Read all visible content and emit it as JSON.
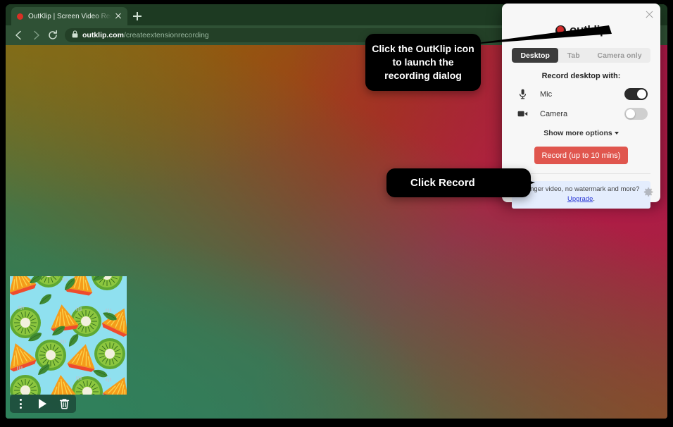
{
  "browser": {
    "tab": {
      "title": "OutKlip | Screen Video Recorde",
      "favicon": "red-dot-favicon",
      "close_icon": "close-icon"
    },
    "new_tab_label": "+",
    "window_close_icon": "window-close-icon",
    "nav": {
      "back_icon": "back-arrow-icon",
      "forward_icon": "forward-arrow-icon",
      "reload_icon": "reload-icon"
    },
    "omnibox": {
      "lock_icon": "lock-icon",
      "domain": "outklip.com",
      "path": "/createextensionrecording"
    },
    "toolbar_icons": [
      {
        "name": "download-icon"
      },
      {
        "name": "share-icon"
      },
      {
        "name": "outklip-extension-icon"
      },
      {
        "name": "extensions-puzzle-icon"
      },
      {
        "name": "profile-avatar-icon"
      },
      {
        "name": "browser-menu-icon"
      }
    ]
  },
  "popup": {
    "close_icon": "close-icon",
    "brand": {
      "mark": "outklip-logo-mark",
      "name": "outklip"
    },
    "tabs": [
      {
        "label": "Desktop",
        "active": true
      },
      {
        "label": "Tab",
        "active": false
      },
      {
        "label": "Camera only",
        "active": false
      }
    ],
    "section_title": "Record desktop with:",
    "options": [
      {
        "icon": "microphone-icon",
        "label": "Mic",
        "enabled": true
      },
      {
        "icon": "camera-icon",
        "label": "Camera",
        "enabled": false
      }
    ],
    "show_more_label": "Show more options",
    "record_button": "Record (up to 10 mins)",
    "upgrade": {
      "text": "Longer video, no watermark and more?",
      "link": "Upgrade",
      "suffix": "."
    },
    "settings_icon": "gear-icon"
  },
  "callouts": [
    {
      "id": "extension",
      "text": "Click the OutKlip icon to launch the recording dialog"
    },
    {
      "id": "record",
      "text": "Click Record"
    }
  ],
  "video_widget": {
    "thumbnail_alt": "kiwi-and-orange-fruit-pattern-thumbnail",
    "controls": [
      {
        "icon": "more-options-icon"
      },
      {
        "icon": "play-icon"
      },
      {
        "icon": "trash-icon"
      }
    ]
  },
  "colors": {
    "browser_chrome": "#1d3a22",
    "toolbar": "#2f5135",
    "record_button": "#e0564e",
    "accent_red": "#d32b2b",
    "upgrade_box": "#e4edfd",
    "upgrade_link": "#2a38d6",
    "toggle_on": "#2b2b2b",
    "toggle_off": "#cfcfcf",
    "callout_bg": "#000000"
  }
}
